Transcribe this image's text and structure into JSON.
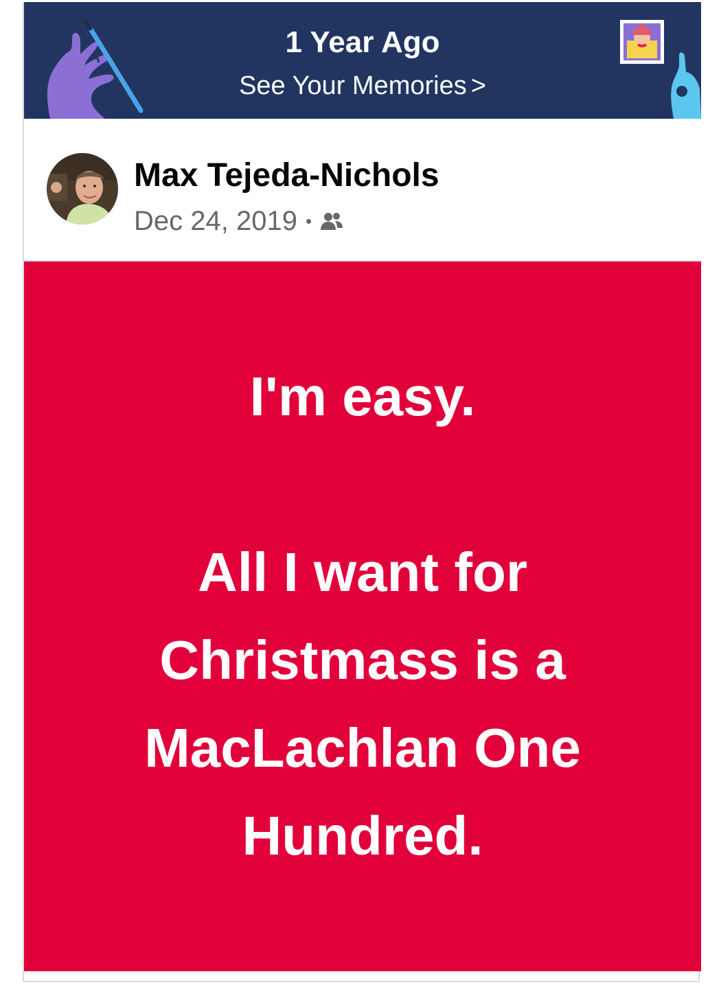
{
  "banner": {
    "title": "1 Year Ago",
    "link_label": "See Your Memories",
    "chevron": ">",
    "background_color": "#223560",
    "left_illustration": "hand-holding-pencil-icon",
    "right_illustration": "hand-holding-photo-icon"
  },
  "post": {
    "author": "Max Tejeda-Nichols",
    "date": "Dec 24, 2019",
    "separator": "•",
    "audience_icon": "friends-icon",
    "avatar_icon": "profile-photo",
    "body_text": "I'm easy.\n\nAll I want for Christmass is a MacLachlan One Hundred.",
    "body_background_color": "#e1003a",
    "body_text_color": "#ffffff"
  }
}
